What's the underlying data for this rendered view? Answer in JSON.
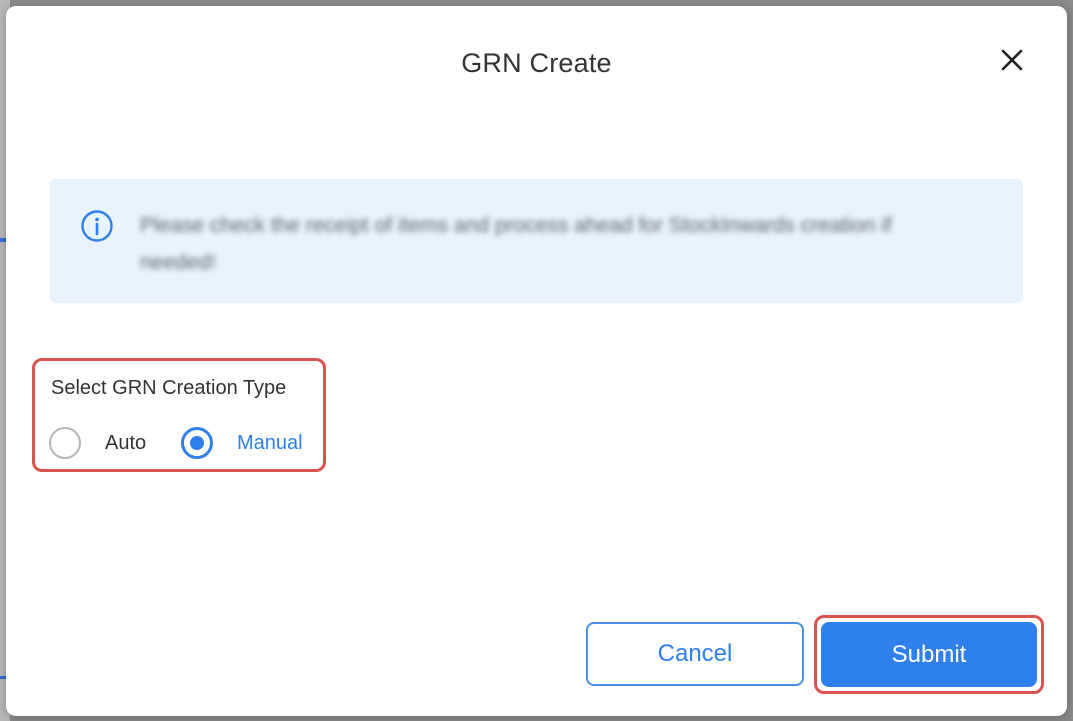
{
  "modal": {
    "title": "GRN Create",
    "close_icon": "close-icon"
  },
  "info_banner": {
    "icon": "info-icon",
    "text": "Please check the receipt of items and process ahead for StockInwards creation if needed!"
  },
  "grn_type": {
    "label": "Select GRN Creation Type",
    "options": [
      {
        "label": "Auto",
        "selected": false
      },
      {
        "label": "Manual",
        "selected": true
      }
    ],
    "selected_value": "Manual"
  },
  "actions": {
    "cancel_label": "Cancel",
    "submit_label": "Submit"
  },
  "colors": {
    "accent": "#2f80ed",
    "highlight": "#d9534f",
    "banner_bg": "#e8f3fd"
  }
}
